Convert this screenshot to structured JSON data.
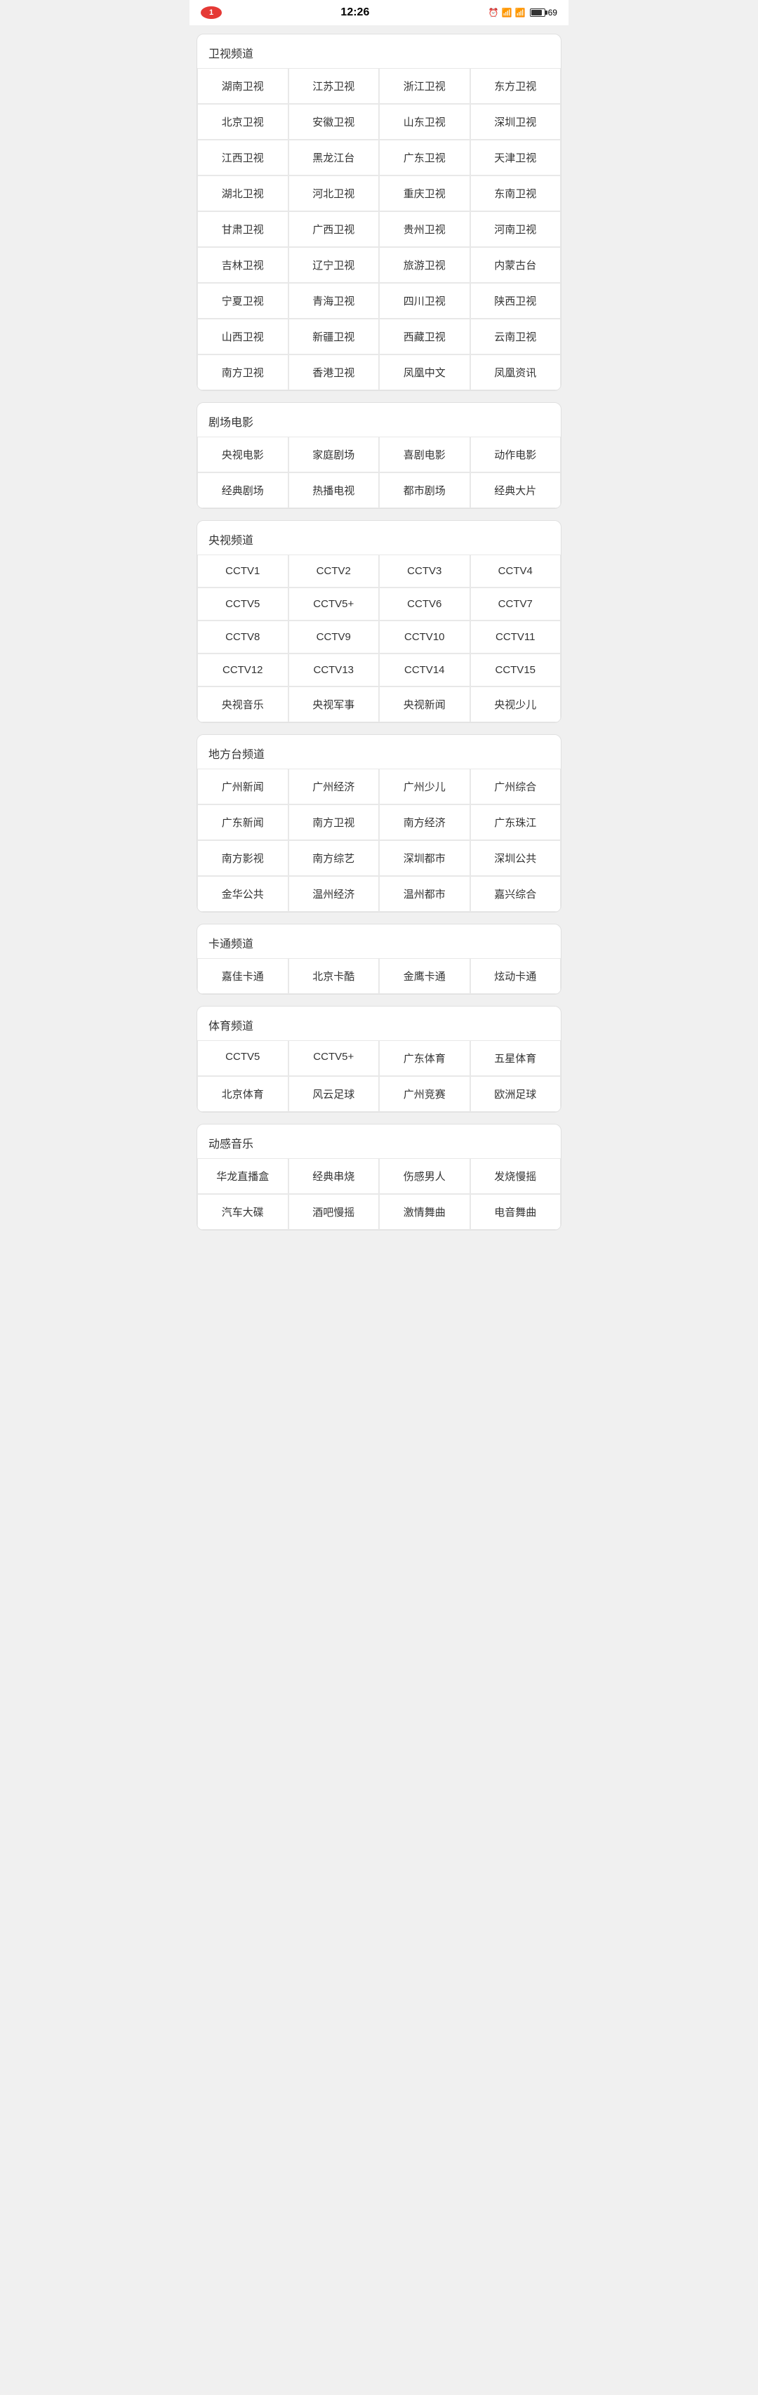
{
  "statusBar": {
    "notification": "1",
    "time": "12:26",
    "battery": "69"
  },
  "sections": [
    {
      "id": "satellite",
      "title": "卫视频道",
      "channels": [
        "湖南卫视",
        "江苏卫视",
        "浙江卫视",
        "东方卫视",
        "北京卫视",
        "安徽卫视",
        "山东卫视",
        "深圳卫视",
        "江西卫视",
        "黑龙江台",
        "广东卫视",
        "天津卫视",
        "湖北卫视",
        "河北卫视",
        "重庆卫视",
        "东南卫视",
        "甘肃卫视",
        "广西卫视",
        "贵州卫视",
        "河南卫视",
        "吉林卫视",
        "辽宁卫视",
        "旅游卫视",
        "内蒙古台",
        "宁夏卫视",
        "青海卫视",
        "四川卫视",
        "陕西卫视",
        "山西卫视",
        "新疆卫视",
        "西藏卫视",
        "云南卫视",
        "南方卫视",
        "香港卫视",
        "凤凰中文",
        "凤凰资讯"
      ]
    },
    {
      "id": "drama-movie",
      "title": "剧场电影",
      "channels": [
        "央视电影",
        "家庭剧场",
        "喜剧电影",
        "动作电影",
        "经典剧场",
        "热播电视",
        "都市剧场",
        "经典大片"
      ]
    },
    {
      "id": "cctv",
      "title": "央视频道",
      "channels": [
        "CCTV1",
        "CCTV2",
        "CCTV3",
        "CCTV4",
        "CCTV5",
        "CCTV5+",
        "CCTV6",
        "CCTV7",
        "CCTV8",
        "CCTV9",
        "CCTV10",
        "CCTV11",
        "CCTV12",
        "CCTV13",
        "CCTV14",
        "CCTV15",
        "央视音乐",
        "央视军事",
        "央视新闻",
        "央视少儿"
      ]
    },
    {
      "id": "local",
      "title": "地方台频道",
      "channels": [
        "广州新闻",
        "广州经济",
        "广州少儿",
        "广州综合",
        "广东新闻",
        "南方卫视",
        "南方经济",
        "广东珠江",
        "南方影视",
        "南方综艺",
        "深圳都市",
        "深圳公共",
        "金华公共",
        "温州经济",
        "温州都市",
        "嘉兴综合"
      ]
    },
    {
      "id": "cartoon",
      "title": "卡通频道",
      "channels": [
        "嘉佳卡通",
        "北京卡酷",
        "金鹰卡通",
        "炫动卡通"
      ]
    },
    {
      "id": "sports",
      "title": "体育频道",
      "channels": [
        "CCTV5",
        "CCTV5+",
        "广东体育",
        "五星体育",
        "北京体育",
        "风云足球",
        "广州竞赛",
        "欧洲足球"
      ]
    },
    {
      "id": "music",
      "title": "动感音乐",
      "channels": [
        "华龙直播盒",
        "经典串烧",
        "伤感男人",
        "发烧慢摇",
        "汽车大碟",
        "酒吧慢摇",
        "激情舞曲",
        "电音舞曲"
      ]
    }
  ]
}
